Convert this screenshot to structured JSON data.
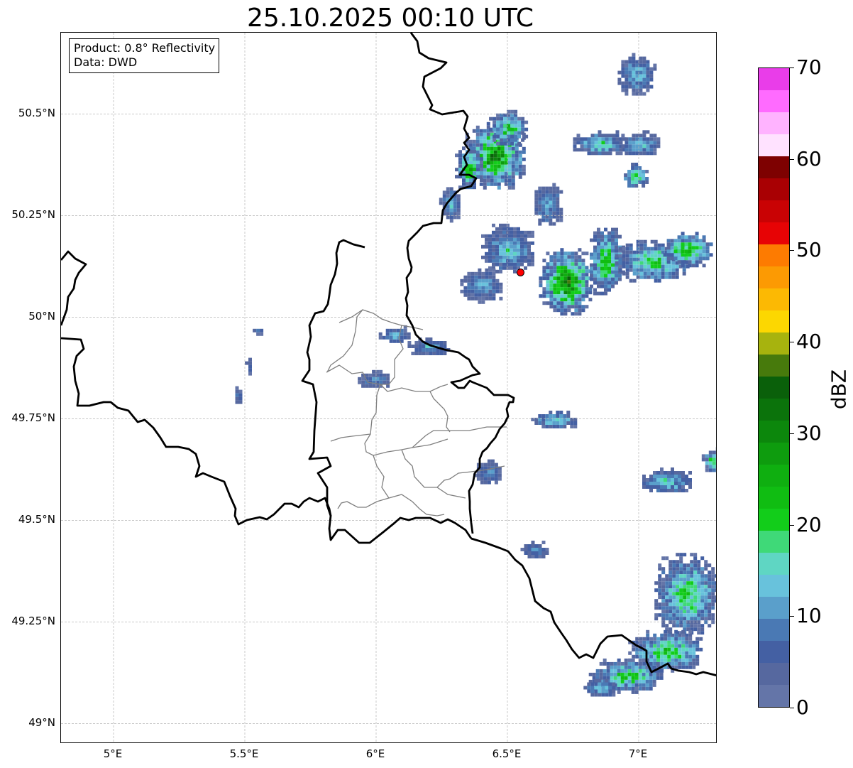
{
  "title": "25.10.2025 00:10 UTC",
  "info": {
    "product": "Product: 0.8° Reflectivity",
    "data": "Data: DWD"
  },
  "axes": {
    "y_ticks": [
      {
        "value": 50.5,
        "label": "50.5°N"
      },
      {
        "value": 50.25,
        "label": "50.25°N"
      },
      {
        "value": 50.0,
        "label": "50°N"
      },
      {
        "value": 49.75,
        "label": "49.75°N"
      },
      {
        "value": 49.5,
        "label": "49.5°N"
      },
      {
        "value": 49.25,
        "label": "49.25°N"
      },
      {
        "value": 49.0,
        "label": "49°N"
      }
    ],
    "x_ticks": [
      {
        "value": 5.0,
        "label": "5°E"
      },
      {
        "value": 5.5,
        "label": "5.5°E"
      },
      {
        "value": 6.0,
        "label": "6°E"
      },
      {
        "value": 6.5,
        "label": "6.5°E"
      },
      {
        "value": 7.0,
        "label": "7°E"
      }
    ],
    "lon_range": [
      4.8,
      7.3
    ],
    "lat_range": [
      48.95,
      50.7
    ]
  },
  "colorbar": {
    "label": "dBZ",
    "ticks": [
      "0",
      "10",
      "20",
      "30",
      "40",
      "50",
      "60",
      "70"
    ],
    "range": [
      0,
      70
    ],
    "bin_colors": [
      "#6475a8",
      "#56689f",
      "#4460a3",
      "#4a79b4",
      "#5a9fcb",
      "#68c2dc",
      "#5fd6c3",
      "#3fd978",
      "#12cd1a",
      "#10bd12",
      "#0faf10",
      "#0e9c0e",
      "#0c870c",
      "#0b730b",
      "#0a600a",
      "#477a0c",
      "#a7b30e",
      "#fcd701",
      "#fcb903",
      "#fc9a03",
      "#fd7b01",
      "#e70305",
      "#c90204",
      "#a90003",
      "#7e0101",
      "#ffe2ff",
      "#ffb3ff",
      "#ff6bff",
      "#e93de9"
    ]
  },
  "marker": {
    "lon": 6.55,
    "lat": 50.11,
    "color": "#ff0000"
  },
  "echoes": [
    {
      "lon": 6.45,
      "lat": 50.4,
      "rlon": 0.11,
      "rlat": 0.08,
      "max_dbz": 32
    },
    {
      "lon": 6.5,
      "lat": 50.47,
      "rlon": 0.07,
      "rlat": 0.04,
      "max_dbz": 24
    },
    {
      "lon": 6.35,
      "lat": 50.37,
      "rlon": 0.05,
      "rlat": 0.05,
      "max_dbz": 28
    },
    {
      "lon": 6.28,
      "lat": 50.28,
      "rlon": 0.04,
      "rlat": 0.04,
      "max_dbz": 14
    },
    {
      "lon": 6.72,
      "lat": 50.09,
      "rlon": 0.1,
      "rlat": 0.08,
      "max_dbz": 33
    },
    {
      "lon": 6.87,
      "lat": 50.14,
      "rlon": 0.07,
      "rlat": 0.08,
      "max_dbz": 24
    },
    {
      "lon": 7.05,
      "lat": 50.14,
      "rlon": 0.14,
      "rlat": 0.05,
      "max_dbz": 22
    },
    {
      "lon": 7.18,
      "lat": 50.17,
      "rlon": 0.1,
      "rlat": 0.04,
      "max_dbz": 24
    },
    {
      "lon": 6.85,
      "lat": 50.43,
      "rlon": 0.1,
      "rlat": 0.03,
      "max_dbz": 18
    },
    {
      "lon": 7.0,
      "lat": 50.43,
      "rlon": 0.08,
      "rlat": 0.03,
      "max_dbz": 14
    },
    {
      "lon": 6.98,
      "lat": 50.35,
      "rlon": 0.05,
      "rlat": 0.03,
      "max_dbz": 22
    },
    {
      "lon": 6.99,
      "lat": 50.6,
      "rlon": 0.07,
      "rlat": 0.05,
      "max_dbz": 14
    },
    {
      "lon": 6.65,
      "lat": 50.28,
      "rlon": 0.06,
      "rlat": 0.05,
      "max_dbz": 12
    },
    {
      "lon": 6.5,
      "lat": 50.17,
      "rlon": 0.1,
      "rlat": 0.06,
      "max_dbz": 16
    },
    {
      "lon": 6.4,
      "lat": 50.08,
      "rlon": 0.08,
      "rlat": 0.04,
      "max_dbz": 12
    },
    {
      "lon": 6.2,
      "lat": 49.93,
      "rlon": 0.08,
      "rlat": 0.02,
      "max_dbz": 14
    },
    {
      "lon": 6.07,
      "lat": 49.96,
      "rlon": 0.06,
      "rlat": 0.02,
      "max_dbz": 12
    },
    {
      "lon": 5.99,
      "lat": 49.85,
      "rlon": 0.06,
      "rlat": 0.02,
      "max_dbz": 10
    },
    {
      "lon": 6.68,
      "lat": 49.75,
      "rlon": 0.09,
      "rlat": 0.02,
      "max_dbz": 16
    },
    {
      "lon": 6.42,
      "lat": 49.62,
      "rlon": 0.05,
      "rlat": 0.03,
      "max_dbz": 10
    },
    {
      "lon": 6.6,
      "lat": 49.43,
      "rlon": 0.05,
      "rlat": 0.02,
      "max_dbz": 10
    },
    {
      "lon": 7.1,
      "lat": 49.6,
      "rlon": 0.1,
      "rlat": 0.03,
      "max_dbz": 16
    },
    {
      "lon": 7.28,
      "lat": 49.65,
      "rlon": 0.04,
      "rlat": 0.03,
      "max_dbz": 24
    },
    {
      "lon": 7.18,
      "lat": 49.32,
      "rlon": 0.12,
      "rlat": 0.1,
      "max_dbz": 22
    },
    {
      "lon": 7.1,
      "lat": 49.18,
      "rlon": 0.14,
      "rlat": 0.05,
      "max_dbz": 24
    },
    {
      "lon": 6.95,
      "lat": 49.12,
      "rlon": 0.14,
      "rlat": 0.04,
      "max_dbz": 22
    },
    {
      "lon": 6.85,
      "lat": 49.09,
      "rlon": 0.06,
      "rlat": 0.02,
      "max_dbz": 16
    },
    {
      "lon": 5.55,
      "lat": 49.97,
      "rlon": 0.02,
      "rlat": 0.01,
      "max_dbz": 8
    },
    {
      "lon": 5.51,
      "lat": 49.88,
      "rlon": 0.01,
      "rlat": 0.02,
      "max_dbz": 8
    },
    {
      "lon": 5.47,
      "lat": 49.81,
      "rlon": 0.02,
      "rlat": 0.02,
      "max_dbz": 8
    }
  ]
}
